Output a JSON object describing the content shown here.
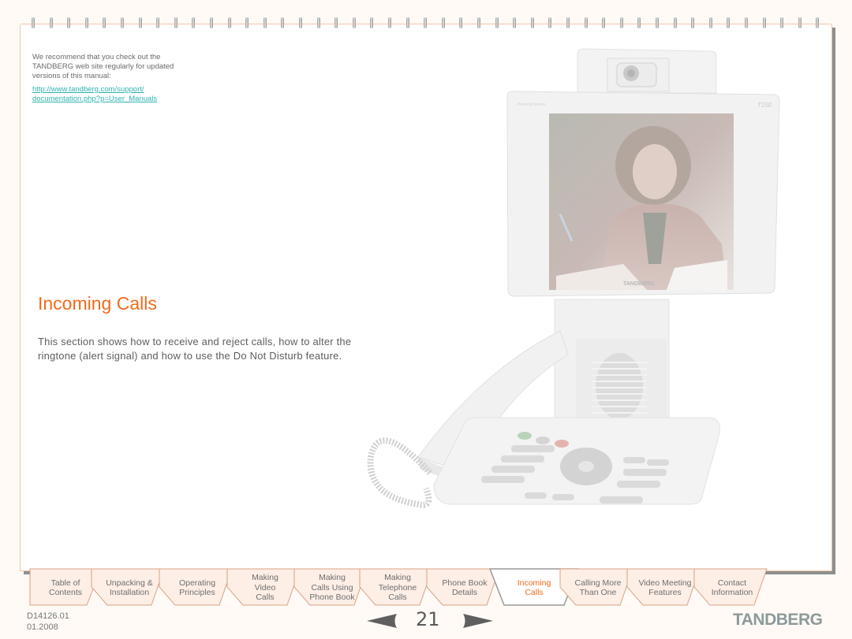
{
  "intro": {
    "text_lines": [
      "We recommend that you check out the",
      "TANDBERG web site regularly for updated",
      "versions of this manual:"
    ],
    "link_lines": [
      "http://www.tandberg.com/support/",
      "documentation.php?p=User_Manuals"
    ]
  },
  "section": {
    "title": "Incoming Calls",
    "description": "This section shows how to receive and reject calls, how to alter the ringtone (alert signal) and how to use the Do Not Disturb feature."
  },
  "phone_image": {
    "brand_label": "TANDBERG",
    "model_label": "T150",
    "series_label": "Personal Series",
    "icons": [
      "camera-icon",
      "speaker-grille-icon",
      "handset-icon",
      "keypad-icon",
      "navigation-dial-icon"
    ]
  },
  "tabs": [
    {
      "label": "Table of\nContents",
      "active": false
    },
    {
      "label": "Unpacking &\nInstallation",
      "active": false
    },
    {
      "label": "Operating\nPrinciples",
      "active": false
    },
    {
      "label": "Making\nVideo\nCalls",
      "active": false
    },
    {
      "label": "Making\nCalls Using\nPhone Book",
      "active": false
    },
    {
      "label": "Making\nTelephone\nCalls",
      "active": false
    },
    {
      "label": "Phone Book\nDetails",
      "active": false
    },
    {
      "label": "Incoming\nCalls",
      "active": true
    },
    {
      "label": "Calling More\nThan One",
      "active": false
    },
    {
      "label": "Video Meeting\nFeatures",
      "active": false
    },
    {
      "label": "Contact\nInformation",
      "active": false
    }
  ],
  "footer": {
    "doc_number": "D14126.01",
    "doc_date": "01.2008",
    "page_number": "21",
    "prev_icon": "arrow-left-icon",
    "next_icon": "arrow-right-icon",
    "logo": "TANDBERG"
  },
  "colors": {
    "accent": "#f26a1b",
    "link": "#2fb3b0",
    "tab_fill": "#fdeee6",
    "tab_border": "#d9a383",
    "page_border": "#f6c3a6",
    "logo": "#8c9a9b"
  }
}
